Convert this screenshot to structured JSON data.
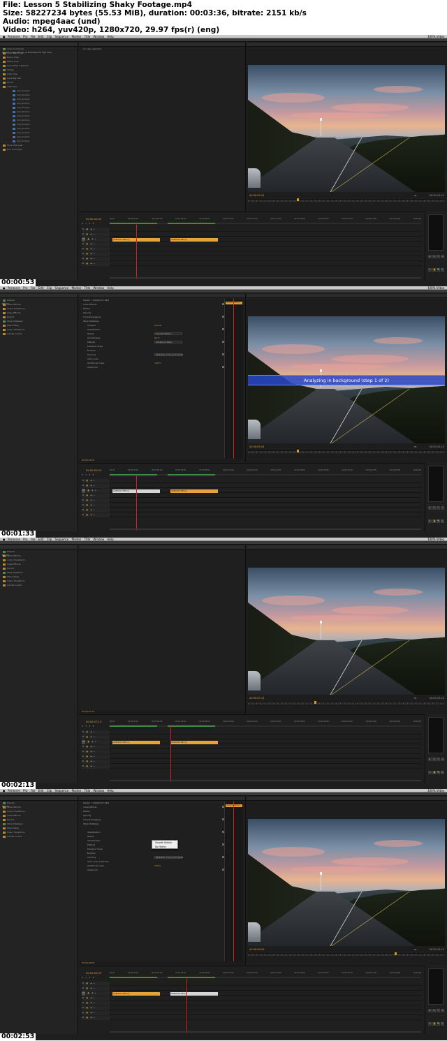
{
  "file_info": {
    "file": "File: Lesson 5 Stabilizing Shaky Footage.mp4",
    "size": "Size: 58227234 bytes (55.53 MiB), duration: 00:03:36, bitrate: 2151 kb/s",
    "audio": "Audio: mpeg4aac (und)",
    "video": "Video: h264, yuv420p, 1280x720, 29.97 fps(r) (eng)"
  },
  "menubar": {
    "apple": "",
    "app_menu": "Premiere Pro File Edit Clip Sequence Marker Title Window Help",
    "tray": "100% Video"
  },
  "frames": [
    {
      "timestamp": "00:00:53",
      "program_tc": "00:00:05:04",
      "timeline_tc": "00:00:05:04",
      "duration_tc": "00:00:15:10",
      "left_tabs": [
        "Project: Copy of Copy of Premiere Pro Tips Cuts"
      ],
      "left_rows": [
        "Color Correction",
        "Color Matching",
        "Name Clips",
        "Name Cuts",
        "Auto white solarized",
        "Shows",
        "Video Clip",
        "Goes Big Hair",
        "On Air",
        "Interview",
        "mm_01.mov",
        "mm_02.mov",
        "mm_03.mov",
        "mm_04.mov",
        "mm_05.mov",
        "mm_06.mov",
        "mm_07.mov",
        "mm_08.mov",
        "mm_09.mov",
        "mm_10.mov",
        "mm_11.mov",
        "mm_12.mov",
        "mm_13.mov",
        "Tools Interview",
        "Doc Thru Eyes"
      ],
      "source_tabs": [
        "Source: (no clips)",
        "Effect Controls",
        "Audio Clip Mixer: Timeline",
        "Metadata"
      ],
      "source_note": "(no clip selected)",
      "clip1": "GOPR0127.MP4 [V]",
      "clip2": "GOPR0127.MP4 [V]",
      "clip2_color": "#e6a33a",
      "banner": ""
    },
    {
      "timestamp": "00:01:33",
      "program_tc": "00:00:05:04",
      "timeline_tc": "00:00:05:04",
      "duration_tc": "00:00:15:10",
      "left_tabs": [
        "Effects"
      ],
      "left_rows": [
        "Presets",
        "Audio Effects",
        "Audio Transitions",
        "Video Effects",
        "Distort",
        "Warp Stabilizer",
        "Wave Warp",
        "Video Transitions",
        "Lumetri Looks"
      ],
      "source_tabs": [
        "Source: (no clips)",
        "Effect Controls",
        "Audio Clip Mixer: Timeline",
        "Metadata"
      ],
      "ec_header": "Master * GOPR0127.MP4",
      "ec_rows": [
        "Video Effects",
        "Motion",
        "Opacity",
        "Time Remapping",
        "Warp Stabilizer",
        "Analyze",
        "Stabilization",
        "Result",
        "Smoothness",
        "Method",
        "Preserve Scale",
        "Borders",
        "Framing",
        "Auto-scale",
        "Additional Scale",
        "Advanced"
      ],
      "ec_values": [
        "",
        "",
        "",
        "",
        "",
        "Cancel",
        "",
        "Smooth Motion",
        "50 %",
        "Subspace Warp",
        "",
        "",
        "Stabilize, Crop, Auto-scale",
        "",
        "100 %",
        ""
      ],
      "ec_footer": "00:00:05:04",
      "clip1": "GOPR0127.MP4 [V]",
      "clip2": "GOPR0127.MP4 [V]",
      "clip2_color": "#e6a33a",
      "banner": "Analyzing in background (step 1 of 2)"
    },
    {
      "timestamp": "00:02:13",
      "program_tc": "00:00:07:14",
      "timeline_tc": "00:00:07:14",
      "duration_tc": "00:00:15:10",
      "left_tabs": [
        "Effects"
      ],
      "left_rows": [
        "Presets",
        "Audio Effects",
        "Audio Transitions",
        "Video Effects",
        "Distort",
        "Warp Stabilizer",
        "Wave Warp",
        "Video Transitions",
        "Lumetri Looks"
      ],
      "source_tabs": [
        "Source: (no clips)",
        "Effect Controls",
        "Audio Clip Mixer: Timeline",
        "Metadata"
      ],
      "source_note": "",
      "ec_footer": "00:00:07:14",
      "clip1": "GOPR0127.MP4 [V]",
      "clip2": "GOPR0127.MP4 [V]",
      "clip2_color": "#e6a33a",
      "banner": ""
    },
    {
      "timestamp": "00:02:53",
      "program_tc": "00:00:09:09",
      "timeline_tc": "00:00:09:09",
      "duration_tc": "00:00:15:10",
      "left_tabs": [
        "Effects"
      ],
      "left_rows": [
        "Presets",
        "Audio Effects",
        "Audio Transitions",
        "Video Effects",
        "Distort",
        "Warp Stabilizer",
        "Wave Warp",
        "Video Transitions",
        "Lumetri Looks"
      ],
      "source_tabs": [
        "Source: (no clips)",
        "Effect Controls",
        "Audio Clip Mixer: Timeline",
        "Metadata"
      ],
      "ec_header": "Master * GOPR0127.MP4",
      "ec_rows": [
        "Video Effects",
        "Motion",
        "Opacity",
        "Time Remapping",
        "Warp Stabilizer",
        "",
        "Stabilization",
        "Result",
        "Smoothness",
        "Method",
        "Preserve Scale",
        "Borders",
        "Framing",
        "Auto-scale (100.0%)",
        "Additional Scale",
        "Advanced"
      ],
      "ec_values": [
        "",
        "",
        "",
        "",
        "",
        "",
        "",
        "",
        "",
        "",
        "",
        "",
        "Stabilize, Crop, Auto-scale",
        "",
        "100 %",
        ""
      ],
      "ec_footer": "00:00:09:09",
      "popup": [
        "Smooth Motion",
        "No Motion"
      ],
      "clip1": "GOPR0127.MP4 [V]",
      "clip2": "GOPR0127.MP4 [V]",
      "clip2_color": "#d6d6d6",
      "banner": ""
    }
  ],
  "program_tab": "Program: Shaky Clip",
  "fit_label": "Fit",
  "ruler_ticks": [
    "00:00",
    "00:00:02:00",
    "00:00:04:00",
    "00:00:06:00",
    "00:00:08:00",
    "00:00:10:00",
    "00:00:12:00",
    "00:00:14:00",
    "00:00:16:00",
    "00:00:18:00",
    "00:00:20:00",
    "00:00:22:00",
    "00:00:24:00",
    "00:00:26:00",
    "00:00:28:00"
  ],
  "track_labels": [
    "V3",
    "V2",
    "V1",
    "A1",
    "A2",
    "A3",
    "A4",
    "A5"
  ],
  "tool_glyphs": [
    "▸",
    "⇔",
    "✂",
    "↔",
    "✎",
    "✋",
    "🔍",
    "⎘"
  ],
  "transport_glyphs": [
    "{",
    "}",
    "|◂",
    "◂|",
    "▸",
    "|▸",
    "▸|",
    "⇥",
    "⇤",
    "⊞",
    "⊡",
    "▣"
  ]
}
